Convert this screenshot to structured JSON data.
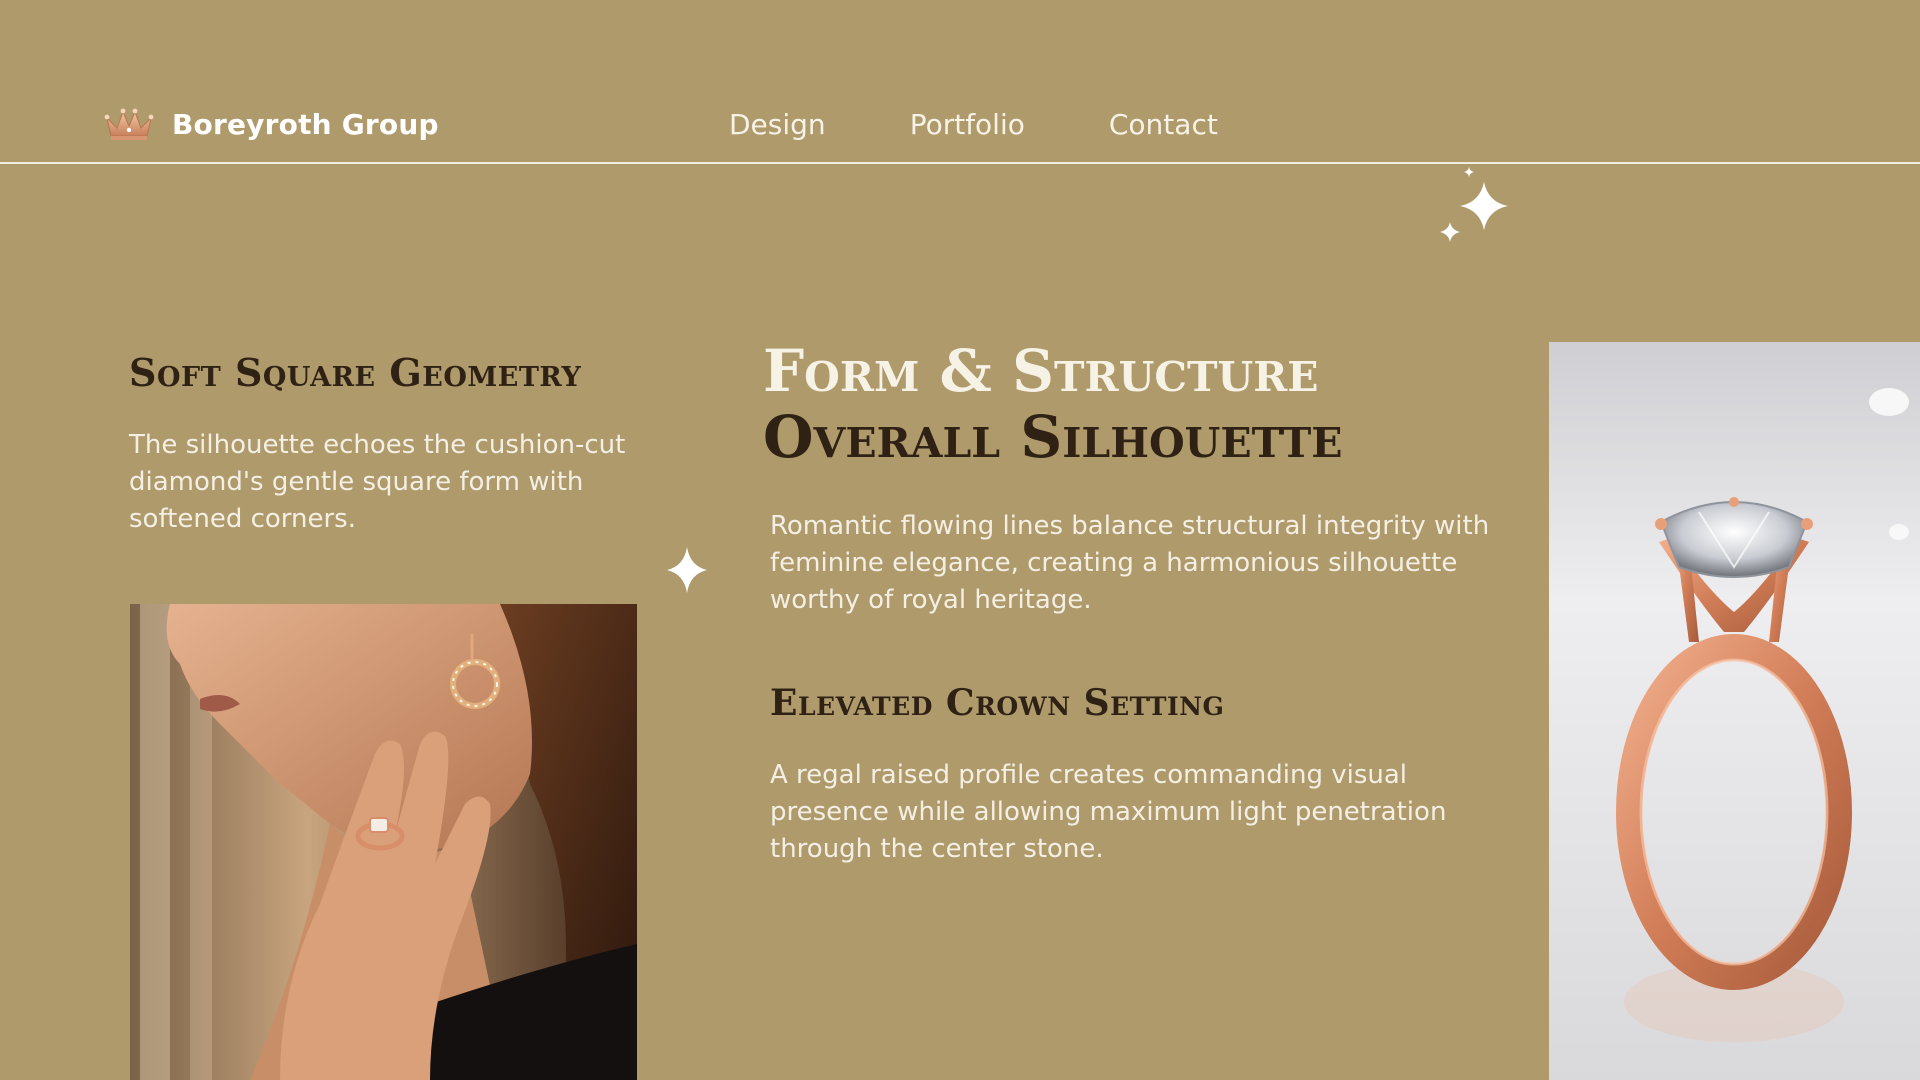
{
  "brand": {
    "name": "Boreyroth Group",
    "logo_icon": "crown-icon"
  },
  "nav": {
    "items": [
      {
        "label": "Design"
      },
      {
        "label": "Portfolio"
      },
      {
        "label": "Contact"
      }
    ]
  },
  "left": {
    "title": "Soft Square Geometry",
    "description": "The silhouette echoes the cushion-cut diamond's gentle square form with softened corners.",
    "image_subject": "woman-wearing-rose-gold-ring-and-earring"
  },
  "main": {
    "title_line1": "Form & Structure",
    "title_line2": "Overall Silhouette",
    "description": "Romantic flowing lines balance structural integrity with feminine elegance, creating a harmonious silhouette worthy of royal heritage.",
    "section_title": "Elevated Crown Setting",
    "section_description": "A regal raised profile creates commanding visual presence while allowing maximum light penetration through the center stone."
  },
  "right": {
    "image_subject": "rose-gold-cushion-cut-solitaire-ring"
  },
  "colors": {
    "background": "#AF9A6B",
    "dark_text": "#2F2215",
    "light_text": "#F4EFE4",
    "rose_gold": "#D98E6A"
  }
}
